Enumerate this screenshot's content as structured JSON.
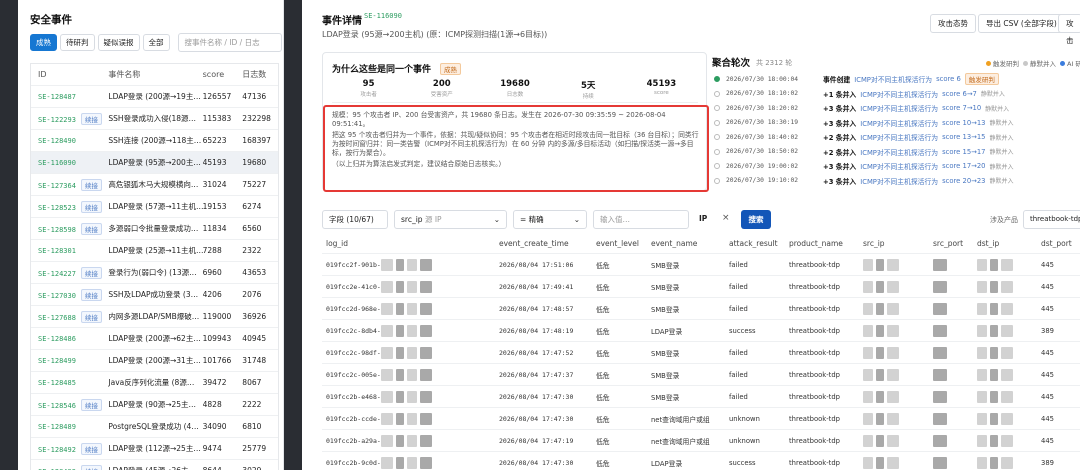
{
  "left_panel": {
    "title": "安全事件",
    "filters": [
      {
        "label": "成熟",
        "active": true
      },
      {
        "label": "待研判",
        "active": false
      },
      {
        "label": "疑似误报",
        "active": false
      },
      {
        "label": "全部",
        "active": false
      }
    ],
    "search_placeholder": "搜事件名称 / ID / 日志",
    "columns": [
      "ID",
      "事件名称",
      "score",
      "日志数"
    ],
    "rows": [
      {
        "id": "SE-128487",
        "tag": "",
        "name": "LDAP登录 (200源→19主…",
        "score": "126557",
        "logs": "47136"
      },
      {
        "id": "SE-122293",
        "tag": "续接",
        "name": "SSH登录成功入侵(18源…",
        "score": "115383",
        "logs": "232298"
      },
      {
        "id": "SE-128490",
        "tag": "",
        "name": "SSH连接 (200源→118主…",
        "score": "65223",
        "logs": "168397"
      },
      {
        "id": "SE-116090",
        "tag": "",
        "name": "LDAP登录 (95源→200主…",
        "score": "45193",
        "logs": "19680",
        "selected": true
      },
      {
        "id": "SE-127364",
        "tag": "续接",
        "name": "高危银狐木马大规模横向…",
        "score": "31024",
        "logs": "75227"
      },
      {
        "id": "SE-128523",
        "tag": "续接",
        "name": "LDAP登录 (57源→11主机…",
        "score": "19153",
        "logs": "6274"
      },
      {
        "id": "SE-128598",
        "tag": "续接",
        "name": "多源弱口令批量登录成功…",
        "score": "11834",
        "logs": "6560"
      },
      {
        "id": "SE-128301",
        "tag": "",
        "name": "LDAP登录 (25源→11主机…",
        "score": "7288",
        "logs": "2322"
      },
      {
        "id": "SE-124227",
        "tag": "续接",
        "name": "登录行为(弱口令) (13源…",
        "score": "6960",
        "logs": "43653"
      },
      {
        "id": "SE-127030",
        "tag": "续接",
        "name": "SSH及LDAP成功登录 (3…",
        "score": "4206",
        "logs": "2076"
      },
      {
        "id": "SE-127688",
        "tag": "续接",
        "name": "内网多源LDAP/SMB爆破…",
        "score": "119000",
        "logs": "36926"
      },
      {
        "id": "SE-128486",
        "tag": "",
        "name": "LDAP登录 (200源→62主…",
        "score": "109943",
        "logs": "40945"
      },
      {
        "id": "SE-128499",
        "tag": "",
        "name": "LDAP登录 (200源→31主…",
        "score": "101766",
        "logs": "31748"
      },
      {
        "id": "SE-128485",
        "tag": "",
        "name": "Java反序列化流量 (8源…",
        "score": "39472",
        "logs": "8067"
      },
      {
        "id": "SE-128546",
        "tag": "续接",
        "name": "LDAP登录 (90源→25主…",
        "score": "4828",
        "logs": "2222"
      },
      {
        "id": "SE-128489",
        "tag": "",
        "name": "PostgreSQL登录成功 (4…",
        "score": "34090",
        "logs": "6810"
      },
      {
        "id": "SE-128492",
        "tag": "续接",
        "name": "LDAP登录 (112源→25主…",
        "score": "9474",
        "logs": "25779"
      },
      {
        "id": "SE-128493",
        "tag": "续接",
        "name": "LDAP登录 (45源→26主…",
        "score": "8644",
        "logs": "3029"
      }
    ]
  },
  "detail": {
    "title": "事件详情",
    "id": "SE-116090",
    "subtitle": "LDAP登录 (95源→200主机) (原：ICMP探测扫描(1源→6目标))",
    "btn_attack": "攻击态势",
    "btn_export": "导出 CSV (全部字段)",
    "btn_more": "攻击",
    "why": {
      "title": "为什么这些是同一个事件",
      "tag": "成熟",
      "stats": [
        {
          "value": "95",
          "label": "攻击者"
        },
        {
          "value": "200",
          "label": "受害资产"
        },
        {
          "value": "19680",
          "label": "日志数"
        },
        {
          "value": "5天",
          "label": "持续"
        },
        {
          "value": "45193",
          "label": "score"
        }
      ],
      "evidence": [
        "规模：95 个攻击者 IP、200 台受害资产，共 19680 条日志。发生在 2026-07-30 09:35:59 ~ 2026-08-04 09:51:41。",
        "把这 95 个攻击者归并为一个事件，依据：共现/疑似协同：95 个攻击者在相近时段攻击同一批目标（36 台目标）；同类行为按时间窗归并：同一类告警（ICMP对不同主机探活行为）在 60 分钟 内的多源/多目标活动（如扫描/探活类一源→多目标，按行为聚合）。",
        "（以上归并为算法启发式判定，建议结合原始日志核实。）"
      ]
    },
    "agg": {
      "title": "聚合轮次",
      "count": "共 2312 轮",
      "legend": [
        {
          "label": "触发研判",
          "color": "#f0a020"
        },
        {
          "label": "静默并入",
          "color": "#c8c8c8"
        },
        {
          "label": "AI 研判",
          "color": "#3b7ddd"
        }
      ],
      "rounds": [
        {
          "time": "2026/07/30 18:00:04",
          "action": "事件创建",
          "desc": "ICMP对不同主机探活行为",
          "extra": "score 6",
          "tag": "触发研判",
          "first": true
        },
        {
          "time": "2026/07/30 18:10:02",
          "action": "+1 条并入",
          "desc": "ICMP对不同主机探活行为",
          "extra": "score 6→7",
          "tag": "静默并入"
        },
        {
          "time": "2026/07/30 18:20:02",
          "action": "+3 条并入",
          "desc": "ICMP对不同主机探活行为",
          "extra": "score 7→10",
          "tag": "静默并入"
        },
        {
          "time": "2026/07/30 18:30:19",
          "action": "+3 条并入",
          "desc": "ICMP对不同主机探活行为",
          "extra": "score 10→13",
          "tag": "静默并入"
        },
        {
          "time": "2026/07/30 18:40:02",
          "action": "+2 条并入",
          "desc": "ICMP对不同主机探活行为",
          "extra": "score 13→15",
          "tag": "静默并入"
        },
        {
          "time": "2026/07/30 18:50:02",
          "action": "+2 条并入",
          "desc": "ICMP对不同主机探活行为",
          "extra": "score 15→17",
          "tag": "静默并入"
        },
        {
          "time": "2026/07/30 19:00:02",
          "action": "+3 条并入",
          "desc": "ICMP对不同主机探活行为",
          "extra": "score 17→20",
          "tag": "静默并入"
        },
        {
          "time": "2026/07/30 19:10:02",
          "action": "+3 条并入",
          "desc": "ICMP对不同主机探活行为",
          "extra": "score 20→23",
          "tag": "静默并入"
        }
      ]
    },
    "toolbar": {
      "field": "字段 (10/67)",
      "src_ip": "src_ip",
      "src_ip_hint": "源 IP",
      "op": "= 精确",
      "input_placeholder": "输入值…",
      "tag_ip": "IP",
      "close": "×",
      "search": "搜索",
      "product_label": "涉及产品",
      "product": "threatbook-tdp"
    },
    "columns": [
      "log_id",
      "event_create_time",
      "event_level",
      "event_name",
      "attack_result",
      "product_name",
      "src_ip",
      "src_port",
      "dst_ip",
      "dst_port"
    ],
    "logs": [
      {
        "log_id": "019fcc2f-901b-",
        "time": "2026/08/04 17:51:06",
        "level": "低危",
        "name": "SMB登录",
        "result": "failed",
        "product": "threatbook-tdp",
        "dst_port": "445"
      },
      {
        "log_id": "019fcc2e-41c0-",
        "time": "2026/08/04 17:49:41",
        "level": "低危",
        "name": "SMB登录",
        "result": "failed",
        "product": "threatbook-tdp",
        "dst_port": "445"
      },
      {
        "log_id": "019fcc2d-968e-",
        "time": "2026/08/04 17:48:57",
        "level": "低危",
        "name": "SMB登录",
        "result": "failed",
        "product": "threatbook-tdp",
        "dst_port": "445"
      },
      {
        "log_id": "019fcc2c-8db4-",
        "time": "2026/08/04 17:48:19",
        "level": "低危",
        "name": "LDAP登录",
        "result": "success",
        "product": "threatbook-tdp",
        "dst_port": "389"
      },
      {
        "log_id": "019fcc2c-98df-",
        "time": "2026/08/04 17:47:52",
        "level": "低危",
        "name": "SMB登录",
        "result": "failed",
        "product": "threatbook-tdp",
        "dst_port": "445"
      },
      {
        "log_id": "019fcc2c-005e-",
        "time": "2026/08/04 17:47:37",
        "level": "低危",
        "name": "SMB登录",
        "result": "failed",
        "product": "threatbook-tdp",
        "dst_port": "445"
      },
      {
        "log_id": "019fcc2b-e468-",
        "time": "2026/08/04 17:47:30",
        "level": "低危",
        "name": "SMB登录",
        "result": "failed",
        "product": "threatbook-tdp",
        "dst_port": "445"
      },
      {
        "log_id": "019fcc2b-ccde-",
        "time": "2026/08/04 17:47:30",
        "level": "低危",
        "name": "net查询域用户或组",
        "result": "unknown",
        "product": "threatbook-tdp",
        "dst_port": "445"
      },
      {
        "log_id": "019fcc2b-a29a-",
        "time": "2026/08/04 17:47:19",
        "level": "低危",
        "name": "net查询域用户或组",
        "result": "unknown",
        "product": "threatbook-tdp",
        "dst_port": "445"
      },
      {
        "log_id": "019fcc2b-9c0d-",
        "time": "2026/08/04 17:47:30",
        "level": "低危",
        "name": "LDAP登录",
        "result": "success",
        "product": "threatbook-tdp",
        "dst_port": "389"
      }
    ]
  }
}
